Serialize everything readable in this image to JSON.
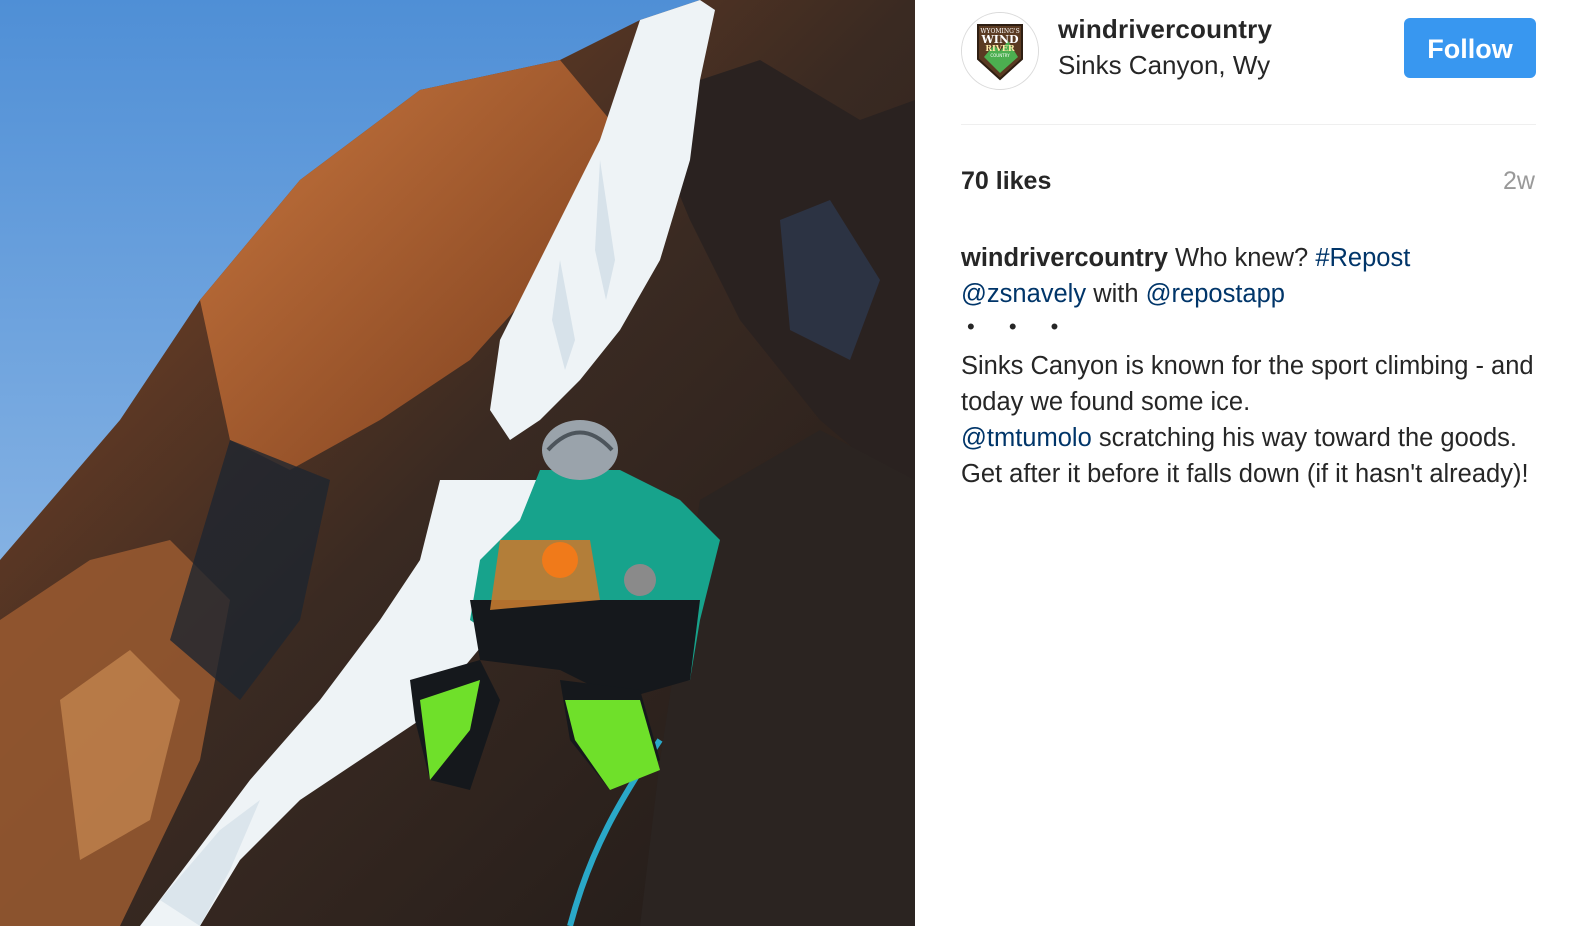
{
  "post": {
    "image_alt_icon": "ice-climber-photo",
    "account": {
      "username": "windrivercountry",
      "location": "Sinks Canyon, Wy",
      "avatar_icon": "wind-river-country-logo",
      "logo_text": [
        "WYOMING'S",
        "WIND",
        "RIVER",
        "COUNTRY"
      ]
    },
    "follow_label": "Follow",
    "likes": "70 likes",
    "time_ago": "2w",
    "caption": {
      "username": "windrivercountry",
      "intro": "Who knew?",
      "hashtag": "#Repost",
      "mention1": "@zsnavely",
      "with_word": "with",
      "mention2": "@repostapp",
      "dots": "• • •",
      "line1": "Sinks Canyon is known for the sport climbing - and today we found some ice.",
      "mention3": "@tmtumolo",
      "line2": "scratching his way toward the goods. Get after it before it falls down (if it hasn't already)!"
    },
    "colors": {
      "follow_button": "#3897f0",
      "link": "#003569",
      "muted": "#999999"
    }
  }
}
